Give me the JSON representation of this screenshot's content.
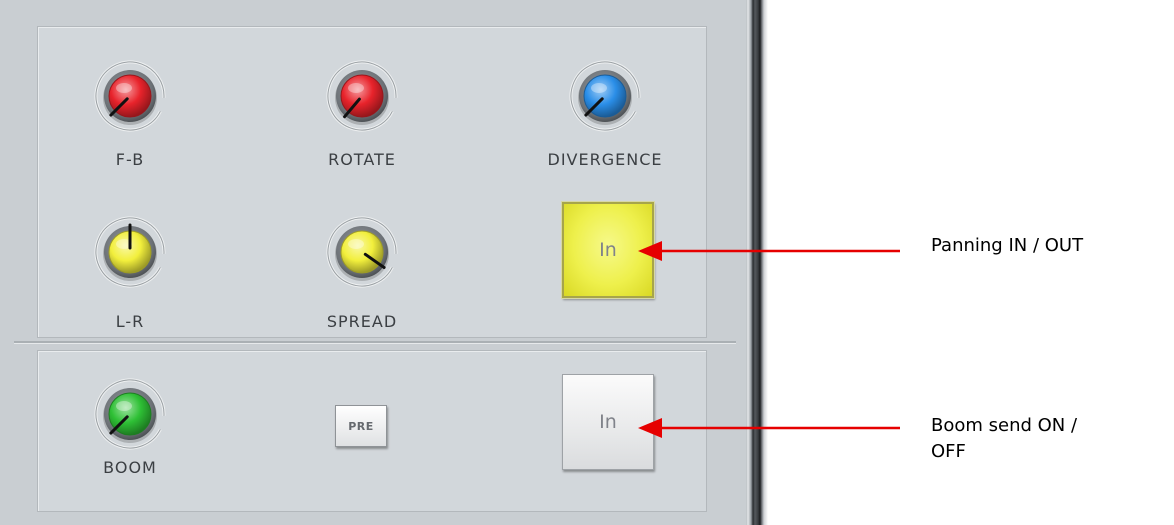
{
  "knobs": [
    {
      "id": "fb",
      "label": "F-B",
      "color": "#e8232b",
      "angle": 225
    },
    {
      "id": "rotate",
      "label": "ROTATE",
      "color": "#e8232b",
      "angle": 220
    },
    {
      "id": "divergence",
      "label": "DIVERGENCE",
      "color": "#2a8ee8",
      "angle": 225
    },
    {
      "id": "lr",
      "label": "L-R",
      "color": "#f2ef3c",
      "angle": 0
    },
    {
      "id": "spread",
      "label": "SPREAD",
      "color": "#f2ef3c",
      "angle": 125
    },
    {
      "id": "boom",
      "label": "BOOM",
      "color": "#2ec035",
      "angle": 225
    }
  ],
  "buttons": {
    "panning_in": "In",
    "pre": "PRE",
    "boom_in": "In"
  },
  "callouts": {
    "panning": "Panning IN / OUT",
    "boom_line1": "Boom send ON /",
    "boom_line2": "OFF"
  },
  "arrow_color": "#e60000"
}
